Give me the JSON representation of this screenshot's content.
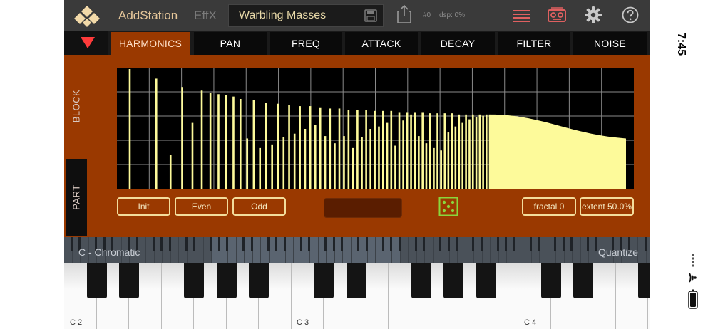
{
  "header": {
    "app_name": "AddStation",
    "fx_tab": "EffX",
    "preset_name": "Warbling Masses",
    "patch_number": "#0",
    "dsp_load": "dsp: 0%"
  },
  "tabs": [
    {
      "label": "HARMONICS",
      "active": true
    },
    {
      "label": "PAN",
      "active": false
    },
    {
      "label": "FREQ",
      "active": false
    },
    {
      "label": "ATTACK",
      "active": false
    },
    {
      "label": "DECAY",
      "active": false
    },
    {
      "label": "FILTER",
      "active": false
    },
    {
      "label": "NOISE",
      "active": false
    }
  ],
  "side_tabs": {
    "block": "BLOCK",
    "part": "PART"
  },
  "harmonics": {
    "bars": [
      1.0,
      0.92,
      0.28,
      0.85,
      0.55,
      0.82,
      0.8,
      0.79,
      0.78,
      0.77,
      0.75,
      0.42,
      0.74,
      0.34,
      0.72,
      0.37,
      0.71,
      0.43,
      0.7,
      0.46,
      0.69,
      0.5,
      0.69,
      0.53,
      0.68,
      0.44,
      0.67,
      0.38,
      0.67,
      0.44,
      0.66,
      0.34,
      0.66,
      0.43,
      0.66,
      0.5,
      0.65,
      0.52,
      0.65,
      0.55,
      0.65,
      0.36,
      0.64,
      0.57,
      0.64,
      0.62,
      0.64,
      0.44,
      0.64,
      0.38,
      0.63,
      0.34,
      0.63,
      0.32,
      0.63,
      0.47,
      0.63,
      0.52,
      0.62,
      0.55,
      0.62,
      0.58,
      0.62,
      0.6,
      0.62,
      0.61,
      0.62,
      0.62
    ],
    "envelope_start": 0.62,
    "envelope_end": 0.42,
    "fill_color": "#fdfa9a",
    "background": "#000000",
    "grid_color": "#8a8a8a"
  },
  "buttons": {
    "init": "Init",
    "even": "Even",
    "odd": "Odd",
    "fractal": "fractal 0",
    "extent": "extent 50.0%"
  },
  "keyboard": {
    "scale": "C - Chromatic",
    "quantize": "Quantize",
    "octave_labels": [
      "C 2",
      "C 3",
      "C 4"
    ]
  },
  "status_bar": {
    "time": "7:45"
  },
  "colors": {
    "accent": "#9a3900",
    "button_outline": "#f3dd9c",
    "header_text": "#e6c79a",
    "icon_red": "#e06060"
  }
}
